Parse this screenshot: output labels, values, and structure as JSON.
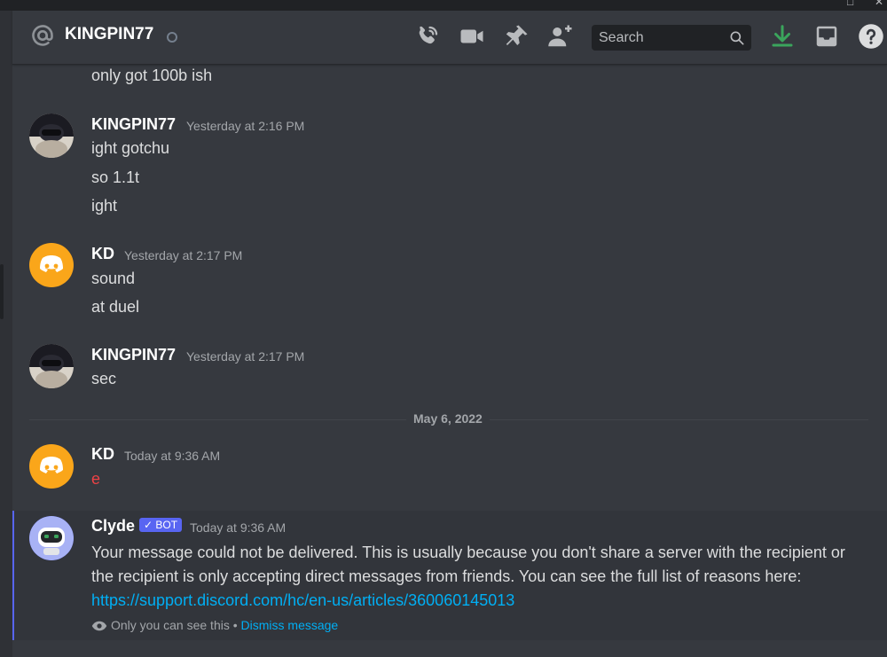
{
  "header": {
    "channel_name": "KINGPIN77",
    "search_placeholder": "Search",
    "icons": [
      "at-icon",
      "status-dot-icon",
      "voice-call-icon",
      "video-call-icon",
      "pin-icon",
      "add-friend-icon",
      "search-icon",
      "download-icon",
      "inbox-icon",
      "help-icon"
    ]
  },
  "messages": {
    "m0_line1": "only got 100b ish",
    "m1": {
      "author": "KINGPIN77",
      "time": "Yesterday at 2:16 PM",
      "lines": [
        "ight gotchu",
        "so 1.1t",
        "ight"
      ]
    },
    "m2": {
      "author": "KD",
      "time": "Yesterday at 2:17 PM",
      "lines": [
        "sound",
        "at duel"
      ]
    },
    "m3": {
      "author": "KINGPIN77",
      "time": "Yesterday at 2:17 PM",
      "lines": [
        "sec"
      ]
    },
    "divider": "May 6, 2022",
    "m4": {
      "author": "KD",
      "time": "Today at 9:36 AM",
      "lines": [
        "e"
      ]
    },
    "clyde": {
      "author": "Clyde",
      "badge": "✓ BOT",
      "time": "Today at 9:36 AM",
      "text": "Your message could not be delivered. This is usually because you don't share a server with the recipient or the recipient is only accepting direct messages from friends. You can see the full list of reasons here: ",
      "link": "https://support.discord.com/hc/en-us/articles/360060145013",
      "only_you": "Only you can see this • ",
      "dismiss": "Dismiss message"
    }
  },
  "colors": {
    "accent": "#5865f2",
    "link": "#00aff4",
    "kd_avatar": "#faa61a",
    "download": "#3ba55c",
    "red_text": "#ed4245"
  }
}
